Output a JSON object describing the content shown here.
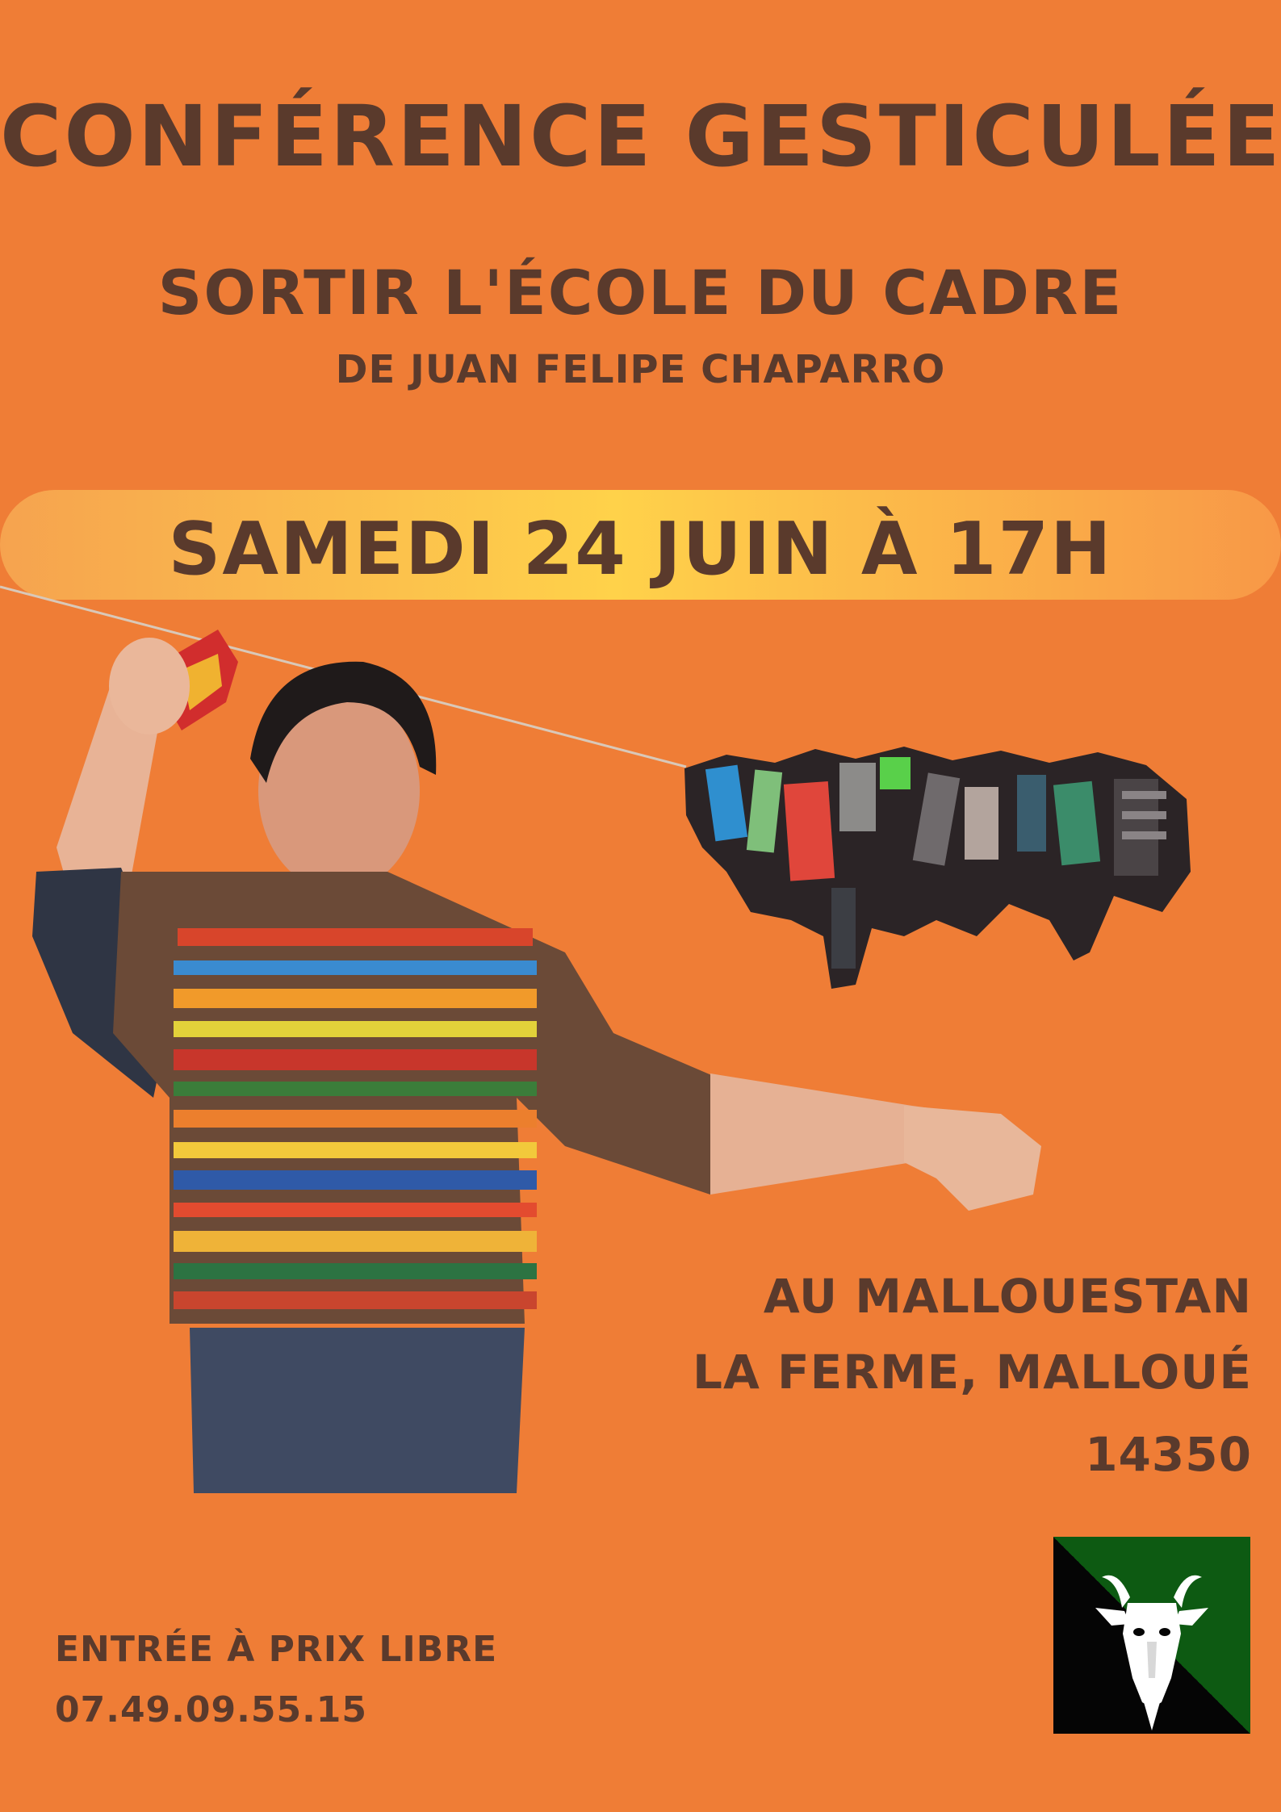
{
  "title": "Conférence gesticulée",
  "subtitle": "Sortir l'école du cadre",
  "author": "de Juan Felipe Chaparro",
  "date": "Samedi 24 juin à 17H",
  "venue": {
    "line1": "Au Mallouestan",
    "line2": "La Ferme, Malloué",
    "line3": "14350"
  },
  "info": {
    "entry": "Entrée à prix libre",
    "phone": "07.49.09.55.15"
  },
  "colors": {
    "background": "#ef7d36",
    "text": "#5a3a2c",
    "banner_center": "#ffd24a",
    "logo_green": "#0d5a12",
    "logo_black": "#050505"
  },
  "icons": {
    "logo": "goat-head-icon"
  }
}
